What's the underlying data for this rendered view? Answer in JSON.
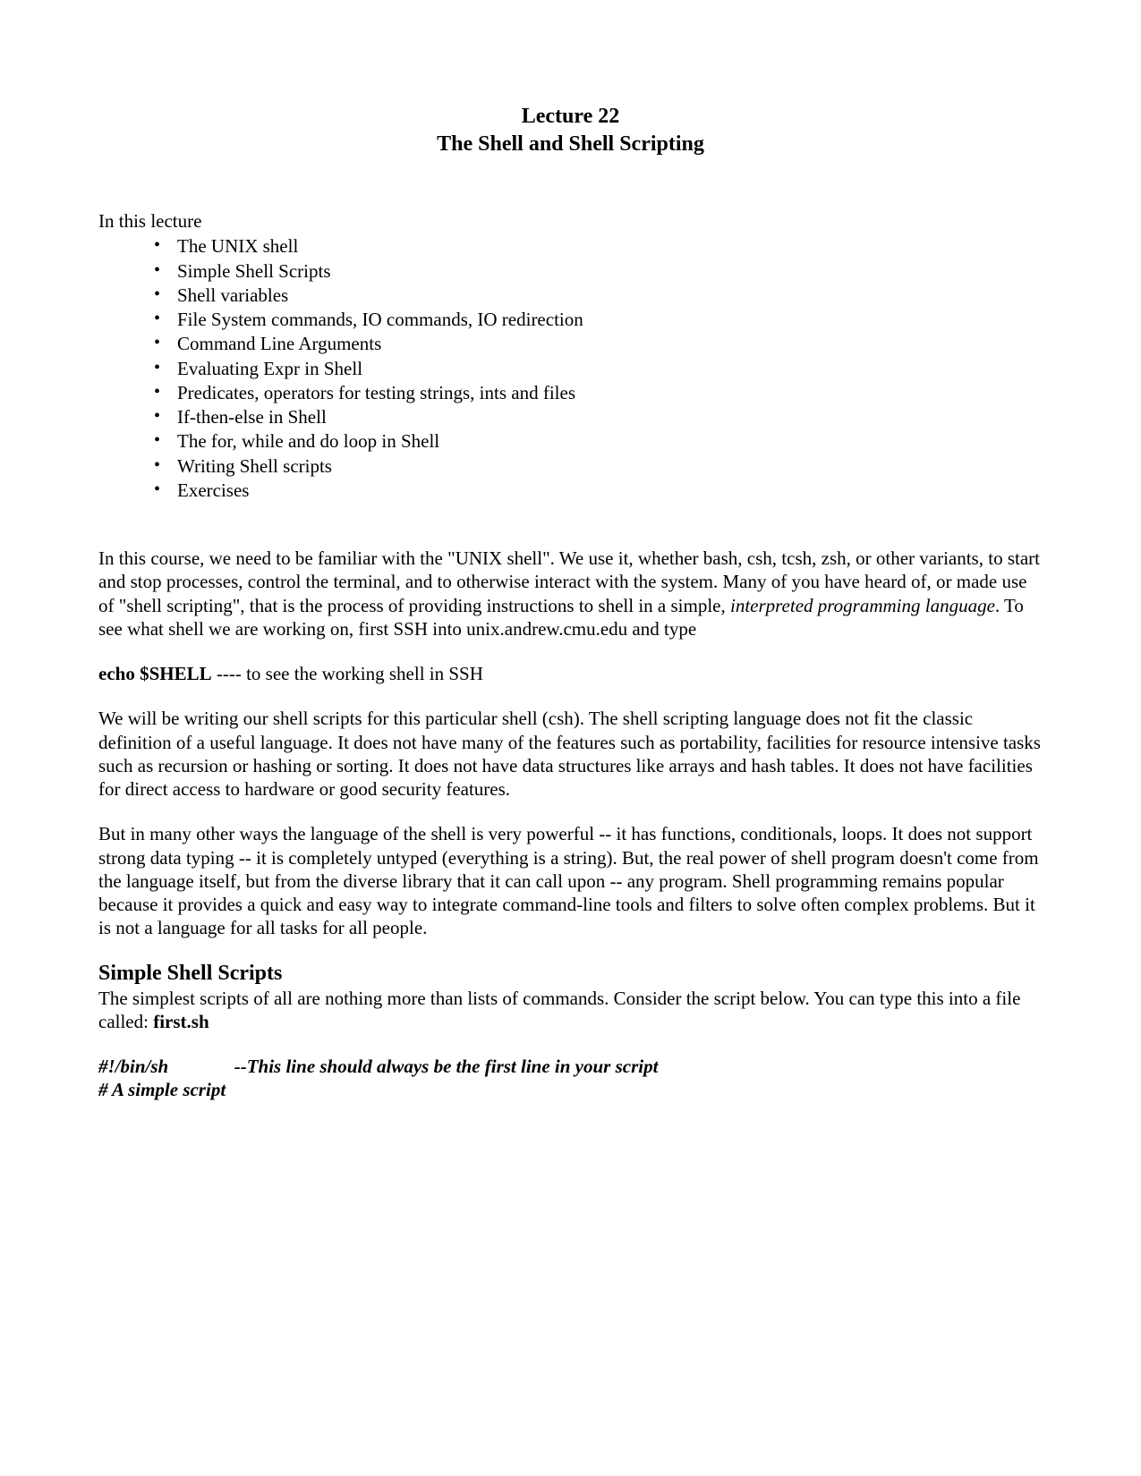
{
  "title": {
    "line1": "Lecture 22",
    "line2": "The Shell and Shell Scripting"
  },
  "intro_label": "In this lecture",
  "topics": [
    "The UNIX shell",
    "Simple Shell Scripts",
    "Shell variables",
    "File System commands, IO commands, IO redirection",
    "Command Line Arguments",
    "Evaluating Expr in Shell",
    "Predicates, operators for testing strings, ints and files",
    "If-then-else in Shell",
    "The for, while and do loop in Shell",
    "Writing Shell scripts",
    "Exercises"
  ],
  "para1": {
    "pre": "In this course, we need to be familiar with the \"UNIX shell\". We use it, whether bash, csh, tcsh, zsh, or other variants, to start and stop processes, control the terminal, and to otherwise interact with the system. Many of you have heard of, or made use of \"shell scripting\", that is the process of providing instructions to shell in a simple, ",
    "italic": "interpreted programming language",
    "post": ". To see what shell we are working on, first SSH into unix.andrew.cmu.edu and type"
  },
  "cmd": {
    "bold": "echo  $SHELL",
    "rest": "    ----  to see the working shell in SSH"
  },
  "para2": "We will be writing our shell scripts for this particular shell (csh). The shell scripting language does not fit the classic definition of a useful language. It does not have many of the features such as portability, facilities for resource intensive tasks such as recursion or hashing or sorting. It does not have data structures like arrays and hash tables. It does not have facilities for direct access to hardware or good security features.",
  "para3": "But in many other ways the language of the shell is very powerful -- it has functions, conditionals, loops. It does not support strong data typing -- it is completely untyped (everything is a string). But, the real power of shell program doesn't come from the language itself, but from the diverse library that it can call upon -- any program. Shell programming remains popular because it provides a quick and easy way to integrate command-line tools and filters to solve often complex problems. But it is not a language for all tasks for all people.",
  "section1": {
    "heading": "Simple Shell Scripts",
    "para_pre": "The simplest scripts of all are nothing more than lists of commands. Consider the script below. You can type this into a file called: ",
    "para_bold": "first.sh"
  },
  "code": {
    "line1a": "#!/bin/sh",
    "line1b": "--This line should always be the first line in your script",
    "line2": "# A simple script"
  }
}
